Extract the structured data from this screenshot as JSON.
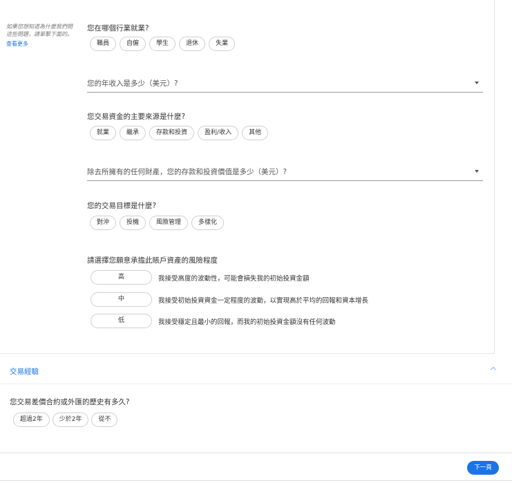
{
  "help": {
    "text": "如果您想知道為什麼我們問這些問題，請單擊下面的。",
    "more_link": "查看更多"
  },
  "industry": {
    "question": "您在哪個行業就業?",
    "options": [
      "職員",
      "自僱",
      "學生",
      "退休",
      "失業"
    ]
  },
  "income": {
    "placeholder": "您的年收入是多少（美元）?"
  },
  "funds_source": {
    "question": "您交易資金的主要來源是什麼?",
    "options": [
      "就業",
      "繼承",
      "存款和投資",
      "盈利/收入",
      "其他"
    ]
  },
  "savings": {
    "placeholder": "除去所擁有的任何財產，您的存款和投資價值是多少（美元）?"
  },
  "goal": {
    "question": "您的交易目標是什麼?",
    "options": [
      "對沖",
      "投機",
      "風險管理",
      "多樣化"
    ]
  },
  "risk": {
    "question": "請選擇您願意承擔此賬戶資產的風險程度",
    "levels": [
      {
        "label": "高",
        "desc": "我接受高度的波動性，可能會損失我的初始投資金額"
      },
      {
        "label": "中",
        "desc": "我接受初始投資資金一定程度的波動，以實現高於平均的回報和資本增長"
      },
      {
        "label": "低",
        "desc": "我接受穩定且最小的回報，而我的初始投資金額沒有任何波動"
      }
    ]
  },
  "experience_section": {
    "title": "交易經驗",
    "question": "您交易差價合約或外匯的歷史有多久?",
    "options": [
      "超過2年",
      "少於2年",
      "從不"
    ]
  },
  "footer": {
    "next_label": "下一頁"
  }
}
